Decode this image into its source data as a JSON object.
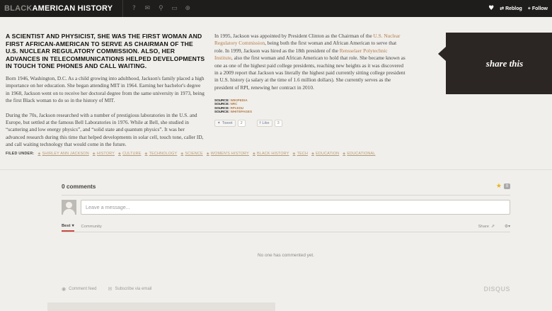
{
  "topbar": {
    "brand_part1": "BLACK",
    "brand_part2": "AMERICAN HISTORY",
    "icons": [
      "help-icon",
      "chat-icon",
      "search-icon",
      "folder-icon",
      "plus-icon"
    ],
    "reblog_label": "Reblog",
    "follow_label": "+ Follow"
  },
  "article": {
    "headline": "A SCIENTIST AND PHYSICIST, SHE WAS THE FIRST WOMAN AND FIRST AFRICAN-AMERICAN TO SERVE AS CHAIRMAN OF THE U.S. NUCLEAR REGULATORY COMMISSION. ALSO, HER ADVANCES IN TELECOMMUNICATIONS HELPED DEVELOPMENTS IN TOUCH TONE PHONES AND CALL WAITING.",
    "para1": "Born 1946, Washington, D.C. As a child growing into adulthood, Jackson's family placed a high importance on her education. She began attending MIT in 1964. Earning her bachelor's degree in 1968, Jackson went on to receive her doctoral degree from the same university in 1973, being the first Black woman to do so in the history of MIT.",
    "para2": "During the 70s, Jackson researched with a number of prestigious laboratories in the U.S. and Europe, but settled at the famous Bell Laboratories in 1976. While at Bell, she studied in “scattering and low energy physics”, and “solid state and quantum physics”. It was her advanced research during this time that helped developments in solar cell, touch tone, caller ID, and call waiting technology that would come in the future.",
    "para3_a": "In 1995, Jackson was appointed by President Clinton as the Chairman of the ",
    "para3_link1": "U.S. Nuclear Regulatory Commission",
    "para3_b": ", being both the first woman and African American to serve that role. In 1999, Jackson was hired as the 18th president of the ",
    "para3_link2": "Rensselaer Polytechnic Institute",
    "para3_c": ", also the first woman and African American to hold that role. She became known as one as one of the highest paid college presidents, reaching new heights as it was discovered in a 2009 report that Jackson was literally the highest paid currently sitting college president in U.S. history (a salary at the time of 1.6 million dollars). She currently serves as the president of RPI, renewing her contract in 2010.",
    "sources": [
      {
        "label": "SOURCE:",
        "value": "WIKIPEDIA"
      },
      {
        "label": "SOURCE:",
        "value": "NRC"
      },
      {
        "label": "SOURCE:",
        "value": "RPI.EDU"
      },
      {
        "label": "SOURCE:",
        "value": "WHITEPAGES"
      }
    ],
    "tweet_label": "Tweet",
    "tweet_count": "2",
    "like_label": "Like",
    "like_count": "3",
    "share_label": "share this"
  },
  "filed_under": {
    "label": "FILED UNDER:",
    "tags": [
      "SHIRLEY ANN JACKSON",
      "HISTORY",
      "CULTURE",
      "TECHNOLOGY",
      "SCIENCE",
      "WOMEN'S HISTORY",
      "BLACK HISTORY",
      "TECH",
      "EDUCATION",
      "EDUCATIONAL"
    ]
  },
  "disqus": {
    "count_label": "0 comments",
    "fav_count": "0",
    "input_placeholder": "Leave a message...",
    "tab_best": "Best",
    "tab_community": "Community",
    "share_label": "Share",
    "empty_text": "No one has commented yet.",
    "comment_feed": "Comment feed",
    "subscribe_email": "Subscribe via email",
    "logo": "DISQUS"
  },
  "colors": {
    "accent_link": "#b07a4a",
    "topbar_bg": "#1f1d1b",
    "share_bg": "#2b2623",
    "page_bg": "#f1efeb"
  }
}
